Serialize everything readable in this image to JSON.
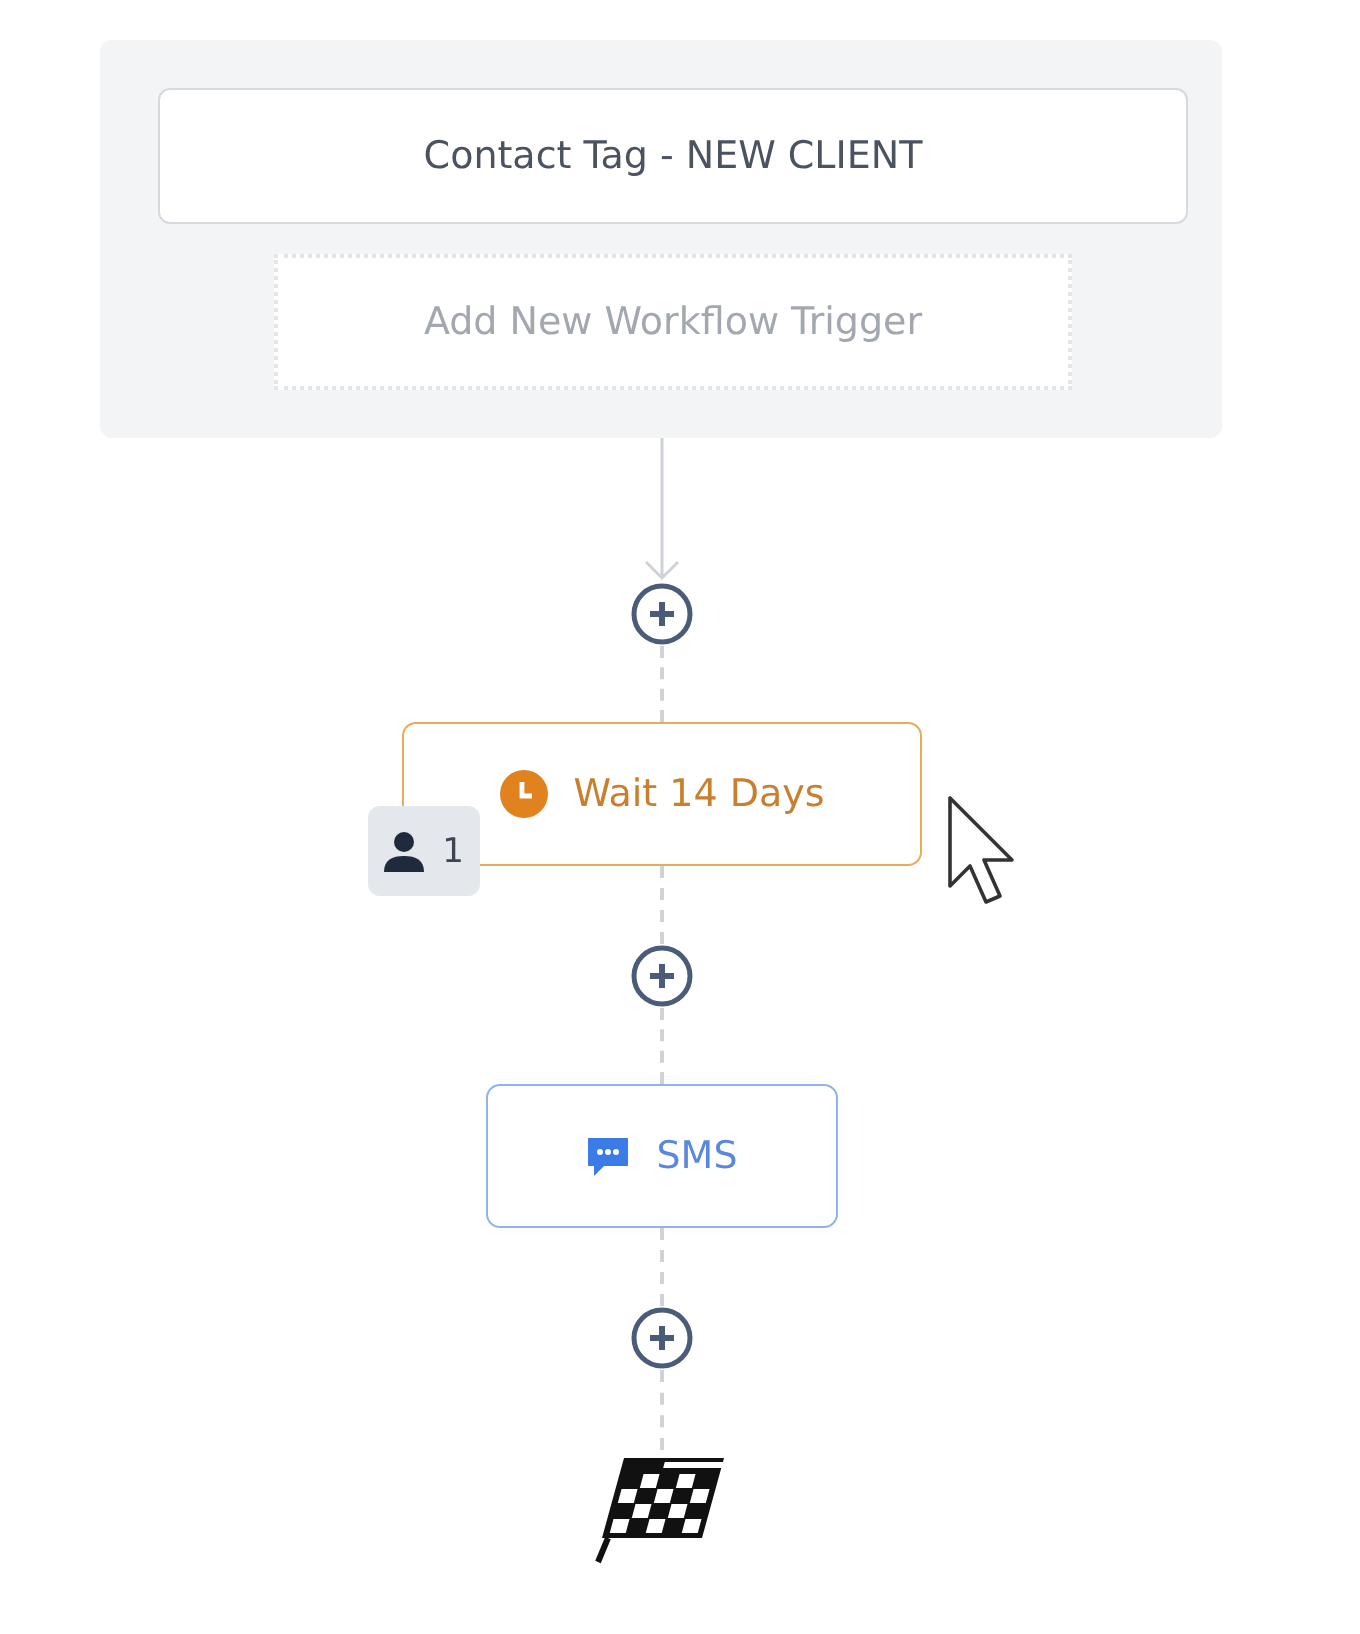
{
  "trigger": {
    "tags": [
      {
        "label": "Contact Tag - NEW CLIENT"
      }
    ],
    "add_label": "Add New Workflow Trigger"
  },
  "steps": [
    {
      "kind": "wait",
      "label": "Wait 14 Days",
      "contacts": "1"
    },
    {
      "kind": "sms",
      "label": "SMS"
    }
  ]
}
